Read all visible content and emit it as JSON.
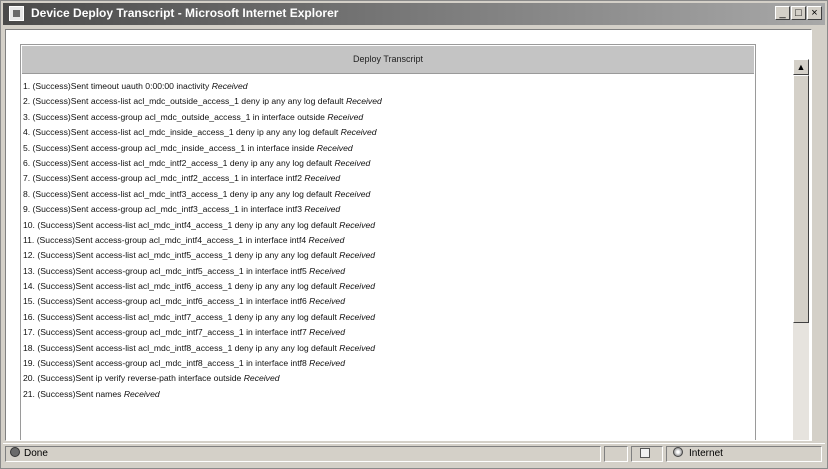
{
  "window": {
    "title": "Device Deploy Transcript - Microsoft Internet Explorer",
    "buttons": {
      "minimize": "_",
      "maximize": "□",
      "close": "×"
    }
  },
  "transcript": {
    "header": "Deploy Transcript",
    "lines": [
      {
        "prefix": "1. (Success)",
        "command": "Sent timeout uauth 0:00:00 inactivity",
        "suffix": "Received"
      },
      {
        "prefix": "2. (Success)",
        "command": "Sent access-list acl_mdc_outside_access_1 deny ip any any log default",
        "suffix": "Received"
      },
      {
        "prefix": "3. (Success)",
        "command": "Sent access-group acl_mdc_outside_access_1 in interface outside",
        "suffix": "Received"
      },
      {
        "prefix": "4. (Success)",
        "command": "Sent access-list acl_mdc_inside_access_1 deny ip any any log default",
        "suffix": "Received"
      },
      {
        "prefix": "5. (Success)",
        "command": "Sent access-group acl_mdc_inside_access_1 in interface inside",
        "suffix": "Received"
      },
      {
        "prefix": "6. (Success)",
        "command": "Sent access-list acl_mdc_intf2_access_1 deny ip any any log default",
        "suffix": "Received"
      },
      {
        "prefix": "7. (Success)",
        "command": "Sent access-group acl_mdc_intf2_access_1 in interface intf2",
        "suffix": "Received"
      },
      {
        "prefix": "8. (Success)",
        "command": "Sent access-list acl_mdc_intf3_access_1 deny ip any any log default",
        "suffix": "Received"
      },
      {
        "prefix": "9. (Success)",
        "command": "Sent access-group acl_mdc_intf3_access_1 in interface intf3",
        "suffix": "Received"
      },
      {
        "prefix": "10. (Success)",
        "command": "Sent access-list acl_mdc_intf4_access_1 deny ip any any log default",
        "suffix": "Received"
      },
      {
        "prefix": "11. (Success)",
        "command": "Sent access-group acl_mdc_intf4_access_1 in interface intf4",
        "suffix": "Received"
      },
      {
        "prefix": "12. (Success)",
        "command": "Sent access-list acl_mdc_intf5_access_1 deny ip any any log default",
        "suffix": "Received"
      },
      {
        "prefix": "13. (Success)",
        "command": "Sent access-group acl_mdc_intf5_access_1 in interface intf5",
        "suffix": "Received"
      },
      {
        "prefix": "14. (Success)",
        "command": "Sent access-list acl_mdc_intf6_access_1 deny ip any any log default",
        "suffix": "Received"
      },
      {
        "prefix": "15. (Success)",
        "command": "Sent access-group acl_mdc_intf6_access_1 in interface intf6",
        "suffix": "Received"
      },
      {
        "prefix": "16. (Success)",
        "command": "Sent access-list acl_mdc_intf7_access_1 deny ip any any log default",
        "suffix": "Received"
      },
      {
        "prefix": "17. (Success)",
        "command": "Sent access-group acl_mdc_intf7_access_1 in interface intf7",
        "suffix": "Received"
      },
      {
        "prefix": "18. (Success)",
        "command": "Sent access-list acl_mdc_intf8_access_1 deny ip any any log default",
        "suffix": "Received"
      },
      {
        "prefix": "19. (Success)",
        "command": "Sent access-group acl_mdc_intf8_access_1 in interface intf8",
        "suffix": "Received"
      },
      {
        "prefix": "20. (Success)",
        "command": "Sent ip verify reverse-path interface outside",
        "suffix": "Received"
      },
      {
        "prefix": "21. (Success)",
        "command": "Sent names",
        "suffix": "Received"
      }
    ]
  },
  "scrollbar": {
    "up": "▲",
    "down": "▼"
  },
  "status": {
    "text": "Done",
    "zone": "Internet"
  },
  "icons": {
    "app": "ie-page-icon",
    "status": "ie-icon",
    "lock": "lock-icon",
    "zone": "globe-icon"
  }
}
